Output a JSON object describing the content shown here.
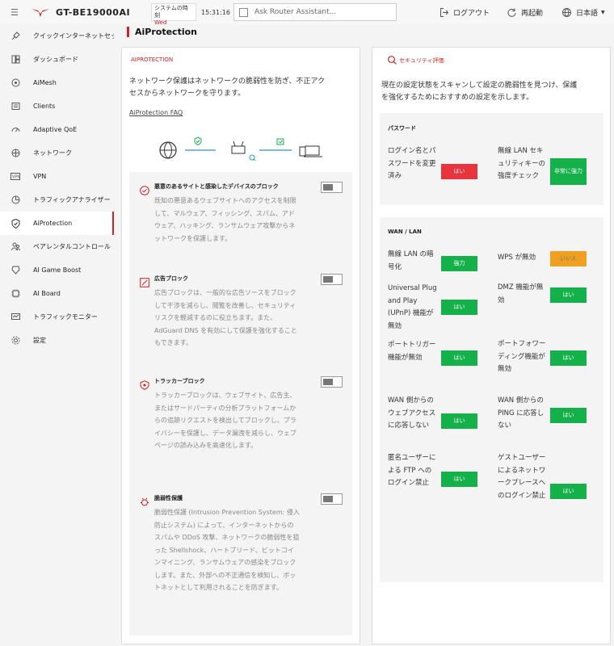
{
  "topbar": {
    "model": "GT-BE19000AI",
    "system_status_label": "システムの時刻",
    "system_status_value": "Wed",
    "time": "15:31:16",
    "search_placeholder": "Ask Router Assistant...",
    "logout": "ログアウト",
    "reboot": "再起動",
    "language": "日本語"
  },
  "sidebar": {
    "items": [
      {
        "label": "クイックインターネットセットアップ",
        "icon": "quick-setup-icon"
      },
      {
        "label": "ダッシュボード",
        "icon": "dashboard-icon"
      },
      {
        "label": "AiMesh",
        "icon": "aimesh-icon"
      },
      {
        "label": "Clients",
        "icon": "clients-icon"
      },
      {
        "label": "Adaptive QoE",
        "icon": "qos-icon"
      },
      {
        "label": "ネットワーク",
        "icon": "network-icon"
      },
      {
        "label": "VPN",
        "icon": "vpn-icon"
      },
      {
        "label": "トラフィックアナライザー",
        "icon": "analyzer-icon"
      },
      {
        "label": "AiProtection",
        "icon": "shield-icon"
      },
      {
        "label": "ペアレンタルコントロール",
        "icon": "parental-icon"
      },
      {
        "label": "AI Game Boost",
        "icon": "game-icon"
      },
      {
        "label": "AI Board",
        "icon": "board-icon"
      },
      {
        "label": "トラフィックモニター",
        "icon": "monitor-icon"
      },
      {
        "label": "設定",
        "icon": "gear-icon"
      }
    ]
  },
  "page": {
    "title": "AiProtection"
  },
  "left_card": {
    "tag": "AIPROTECTION",
    "desc_line1": "ネットワーク保護はネットワークの脆弱性を防ぎ、不正アク",
    "desc_line2": "セスからネットワークを守ります。",
    "faq": "AiProtection FAQ",
    "features": [
      {
        "title": "悪意のあるサイトと感染したデバイスのブロック",
        "text": "既知の悪意あるウェブサイトへのアクセスを制限して、マルウェア、フィッシング、スパム、アドウェア、ハッキング、ランサムウェア攻撃からネットワークを保護します。"
      },
      {
        "title": "広告ブロック",
        "text": "広告ブロックは、一般的な広告ソースをブロックして干渉を減らし、閲覧を改善し、セキュリティリスクを軽減するのに役立ちます。また、AdGuard DNS を有効にして保護を強化することもできます。"
      },
      {
        "title": "トラッカーブロック",
        "text": "トラッカーブロックは、ウェブサイト、広告主、またはサードパーティの分析プラットフォームからの追跡リクエストを検出してブロックし、プライバシーを保護し、データ漏洩を減らし、ウェブページの読み込みを高速化します。"
      },
      {
        "title": "脆弱性保護",
        "text": "脆弱性保護 (Intrusion Prevention System: 侵入防止システム) によって、インターネットからのスパムや DDoS 攻撃、ネットワークの脆弱性を狙った Shellshock、ハートブリード、ビットコインマイニング、ランサムウェアの感染をブロックします。また、外部への不正通信を検知し、ボットネットとして利用されることを防ぎます。"
      }
    ]
  },
  "right_card": {
    "tag": "セキュリティ評価",
    "desc_line1": "現在の設定状態をスキャンして設定の脆弱性を見つけ、保護",
    "desc_line2": "を強化するためにおすすめの設定を示します。",
    "password_section": {
      "title": "パスワード",
      "items": [
        {
          "label": "ログイン名とパスワードを変更済み",
          "status": "はい",
          "color": "#e8343c"
        },
        {
          "label": "無線 LAN セキュリティキーの強度チェック",
          "status": "非常に強力",
          "color": "#14b14b"
        }
      ]
    },
    "wan_section": {
      "title": "WAN / LAN",
      "items": [
        {
          "label": "無線 LAN の暗号化",
          "status": "強力",
          "color": "#14b14b"
        },
        {
          "label": "WPS が無効",
          "status": "いいえ",
          "color": "#f0a020"
        },
        {
          "label": "Universal Plug and Play (UPnP) 機能が無効",
          "status": "はい",
          "color": "#14b14b"
        },
        {
          "label": "DMZ 機能が無効",
          "status": "はい",
          "color": "#14b14b"
        },
        {
          "label": "ポートトリガー機能が無効",
          "status": "はい",
          "color": "#14b14b"
        },
        {
          "label": "ポートフォワーディング機能が無効",
          "status": "はい",
          "color": "#14b14b"
        },
        {
          "label": "WAN 側からのウェブアクセスに応答しない",
          "status": "はい",
          "color": "#14b14b"
        },
        {
          "label": "WAN 側からの PING に応答しない",
          "status": "はい",
          "color": "#14b14b"
        },
        {
          "label": "匿名ユーザーによる FTP へのログイン禁止",
          "status": "はい",
          "color": "#14b14b"
        },
        {
          "label": "ゲストユーザーによるネットワークプレースへのログイン禁止",
          "status": "はい",
          "color": "#14b14b"
        }
      ]
    }
  }
}
